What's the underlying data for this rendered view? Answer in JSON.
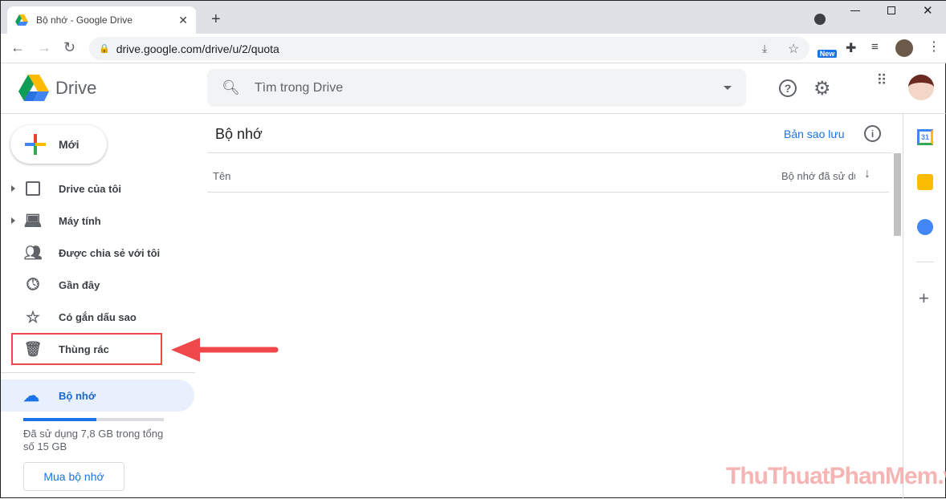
{
  "browser": {
    "tab_title": "Bộ nhớ - Google Drive",
    "url": "drive.google.com/drive/u/2/quota",
    "new_badge": "New"
  },
  "app": {
    "name": "Drive",
    "search_placeholder": "Tìm trong Drive"
  },
  "sidebar": {
    "new_label": "Mới",
    "items": [
      {
        "label": "Drive của tôi"
      },
      {
        "label": "Máy tính"
      },
      {
        "label": "Được chia sẻ với tôi"
      },
      {
        "label": "Gần đây"
      },
      {
        "label": "Có gắn dấu sao"
      },
      {
        "label": "Thùng rác"
      }
    ],
    "storage": {
      "label": "Bộ nhớ",
      "usage_text": "Đã sử dụng 7,8 GB trong tổng số 15 GB",
      "used_fraction": 0.52,
      "buy_label": "Mua bộ nhớ"
    }
  },
  "main": {
    "title": "Bộ nhớ",
    "backup_link": "Bản sao lưu",
    "col_name": "Tên",
    "col_storage": "Bộ nhớ đã sử dụ"
  },
  "side_panel": {
    "calendar_day": "31"
  },
  "watermark": "ThuThuatPhanMem.vn",
  "colors": {
    "accent": "#1a73e8",
    "highlight": "#e8f0fe",
    "annotation": "#f0474a"
  }
}
